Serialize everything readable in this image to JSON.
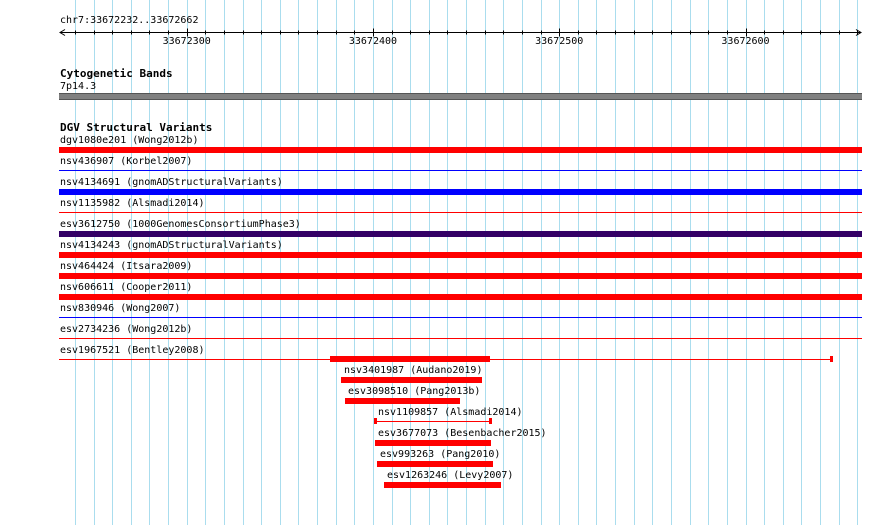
{
  "browser": {
    "region": "chr7:33672232..33672662",
    "ruler": {
      "start": 33672232,
      "end": 33672662,
      "tick_labels": [
        "33672300",
        "33672400",
        "33672500",
        "33672600"
      ]
    },
    "tracks": {
      "cytoband": {
        "title": "Cytogenetic Bands",
        "band": "7p14.3",
        "color": "#808080"
      },
      "dgv": {
        "title": "DGV Structural Variants"
      }
    },
    "colors": {
      "gain": "#ff0000",
      "loss": "#0000ff",
      "gain_loss": "#330066",
      "grid": "#aaddee",
      "ruler": "#000000"
    },
    "variants": [
      {
        "label": "dgv1080e201 (Wong2012b)",
        "start": 33672232,
        "end": 33672662,
        "type": "gain",
        "style": "thick"
      },
      {
        "label": "nsv436907 (Korbel2007)",
        "start": 33672232,
        "end": 33672662,
        "type": "loss",
        "style": "thin"
      },
      {
        "label": "nsv4134691 (gnomADStructuralVariants)",
        "start": 33672232,
        "end": 33672662,
        "type": "loss",
        "style": "thick"
      },
      {
        "label": "nsv1135982 (Alsmadi2014)",
        "start": 33672232,
        "end": 33672662,
        "type": "gain",
        "style": "thin"
      },
      {
        "label": "esv3612750 (1000GenomesConsortiumPhase3)",
        "start": 33672232,
        "end": 33672662,
        "type": "gain_loss",
        "style": "thick"
      },
      {
        "label": "nsv4134243 (gnomADStructuralVariants)",
        "start": 33672232,
        "end": 33672662,
        "type": "gain",
        "style": "thick"
      },
      {
        "label": "nsv464424 (Itsara2009)",
        "start": 33672232,
        "end": 33672662,
        "type": "gain",
        "style": "thick"
      },
      {
        "label": "nsv606611 (Cooper2011)",
        "start": 33672232,
        "end": 33672662,
        "type": "gain",
        "style": "thick"
      },
      {
        "label": "nsv830946 (Wong2007)",
        "start": 33672232,
        "end": 33672662,
        "type": "loss",
        "style": "thin"
      },
      {
        "label": "esv2734236 (Wong2012b)",
        "start": 33672232,
        "end": 33672662,
        "type": "gain",
        "style": "thin"
      },
      {
        "label": "esv1967521 (Bentley2008)",
        "start": 33672232,
        "end": 33672646,
        "type": "gain",
        "style": "thin-capped"
      },
      {
        "label": "nsv3401987 (Audano2019)",
        "start": 33672383,
        "end": 33672458,
        "type": "gain",
        "style": "thick"
      },
      {
        "label": "esv3098510 (Pang2013b)",
        "start": 33672385,
        "end": 33672446,
        "type": "gain",
        "style": "thick"
      },
      {
        "label": "nsv1109857 (Alsmadi2014)",
        "start": 33672401,
        "end": 33672463,
        "type": "gain",
        "style": "thin-capped"
      },
      {
        "label": "esv3677073 (Besenbacher2015)",
        "start": 33672401,
        "end": 33672463,
        "type": "gain",
        "style": "thick"
      },
      {
        "label": "esv993263 (Pang2010)",
        "start": 33672402,
        "end": 33672464,
        "type": "gain",
        "style": "thick"
      },
      {
        "label": "esv1263246 (Levy2007)",
        "start": 33672406,
        "end": 33672468,
        "type": "gain",
        "style": "thick"
      }
    ]
  }
}
